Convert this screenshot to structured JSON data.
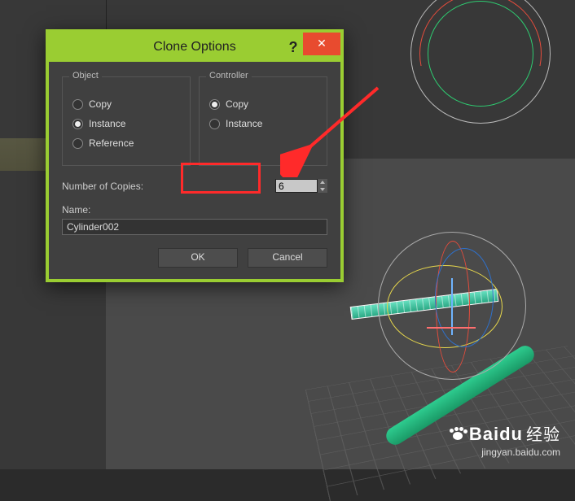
{
  "dialog": {
    "title": "Clone Options",
    "help_symbol": "?",
    "close_symbol": "✕",
    "object_group": {
      "legend": "Object",
      "copy": "Copy",
      "instance": "Instance",
      "reference": "Reference",
      "selected": "instance"
    },
    "controller_group": {
      "legend": "Controller",
      "copy": "Copy",
      "instance": "Instance",
      "selected": "copy"
    },
    "copies_label": "Number of Copies:",
    "copies_value": "6",
    "name_label": "Name:",
    "name_value": "Cylinder002",
    "ok_label": "OK",
    "cancel_label": "Cancel"
  },
  "watermark": {
    "brand_en": "Baidu",
    "brand_cn": "经验",
    "url": "jingyan.baidu.com"
  }
}
